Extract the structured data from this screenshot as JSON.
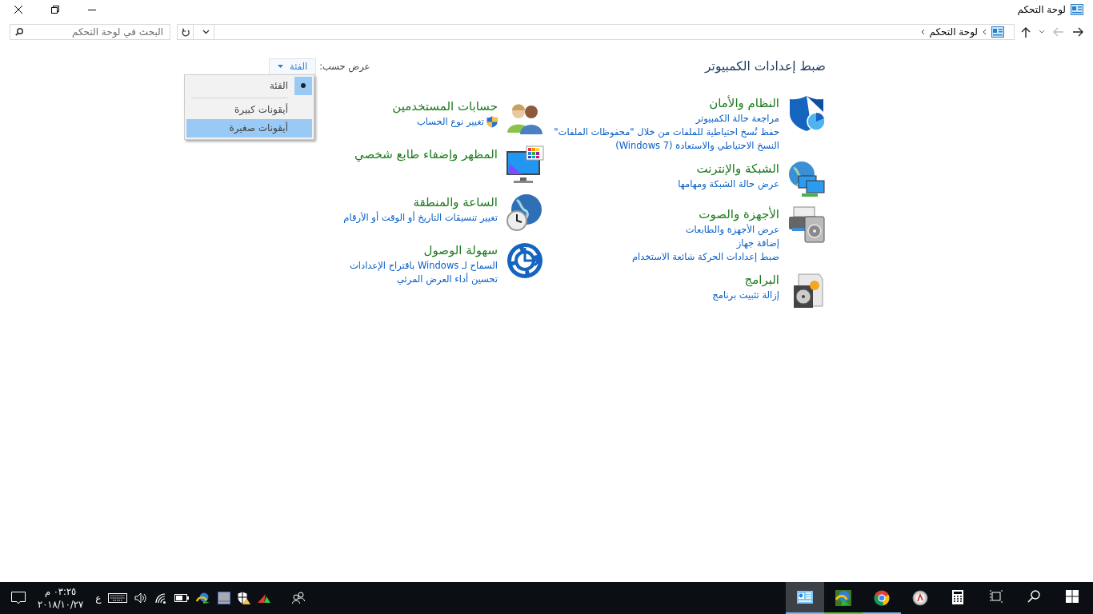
{
  "window": {
    "title": "لوحة التحكم"
  },
  "address_bar": {
    "path": [
      "لوحة التحكم"
    ],
    "search": {
      "placeholder": "البحث في لوحة التحكم"
    }
  },
  "content": {
    "heading": "ضبط إعدادات الكمبيوتر",
    "view_by": {
      "label": "عرض حسب:",
      "value": "الفئة"
    },
    "view_menu": [
      {
        "label": "الفئة",
        "selected": true,
        "highlighted": false
      },
      {
        "label": "أيقونات كبيرة",
        "selected": false,
        "highlighted": false
      },
      {
        "label": "أيقونات صغيرة",
        "selected": false,
        "highlighted": true
      }
    ],
    "columns": [
      [
        {
          "title": "النظام والأمان",
          "links": [
            {
              "text": "مراجعة حالة الكمبيوتر",
              "shield": false
            },
            {
              "text": "حفظ نُسخ احتياطية للملفات من خلال \"محفوظات الملفات\"",
              "shield": false
            },
            {
              "text": "النسخ الاحتياطي والاستعادة (Windows 7)",
              "shield": false
            }
          ]
        },
        {
          "title": "الشبكة والإنترنت",
          "links": [
            {
              "text": "عرض حالة الشبكة ومهامها",
              "shield": false
            }
          ]
        },
        {
          "title": "الأجهزة والصوت",
          "links": [
            {
              "text": "عرض الأجهزة والطابعات",
              "shield": false
            },
            {
              "text": "إضافة جهاز",
              "shield": false
            },
            {
              "text": "ضبط إعدادات الحركة شائعة الاستخدام",
              "shield": false
            }
          ]
        },
        {
          "title": "البرامج",
          "links": [
            {
              "text": "إزالة تثبيت برنامج",
              "shield": false
            }
          ]
        }
      ],
      [
        {
          "title": "حسابات المستخدمين",
          "links": [
            {
              "text": "تغيير نوع الحساب",
              "shield": true
            }
          ]
        },
        {
          "title": "المظهر وإضفاء طابع شخصي"
        },
        {
          "title": "الساعة والمنطقة",
          "links": [
            {
              "text": "تغيير تنسيقات التاريخ أو الوقت أو الأرقام",
              "shield": false
            }
          ]
        },
        {
          "title": "سهولة الوصول",
          "links": [
            {
              "text": "السماح لـ Windows باقتراح الإعدادات",
              "shield": false
            },
            {
              "text": "تحسين أداء العرض المرئي",
              "shield": false
            }
          ]
        }
      ]
    ]
  },
  "taskbar": {
    "apps": [
      {
        "running": false,
        "active": false
      },
      {
        "running": false,
        "active": false
      },
      {
        "running": false,
        "active": false
      },
      {
        "running": false,
        "active": false
      },
      {
        "running": false,
        "active": false
      },
      {
        "running": true,
        "active": false
      },
      {
        "running": true,
        "active": false
      },
      {
        "running": true,
        "active": true
      }
    ],
    "language": "ع",
    "time": "٠٣:٢٥ م",
    "date": "٢٠١٨/١٠/٢٧"
  }
}
